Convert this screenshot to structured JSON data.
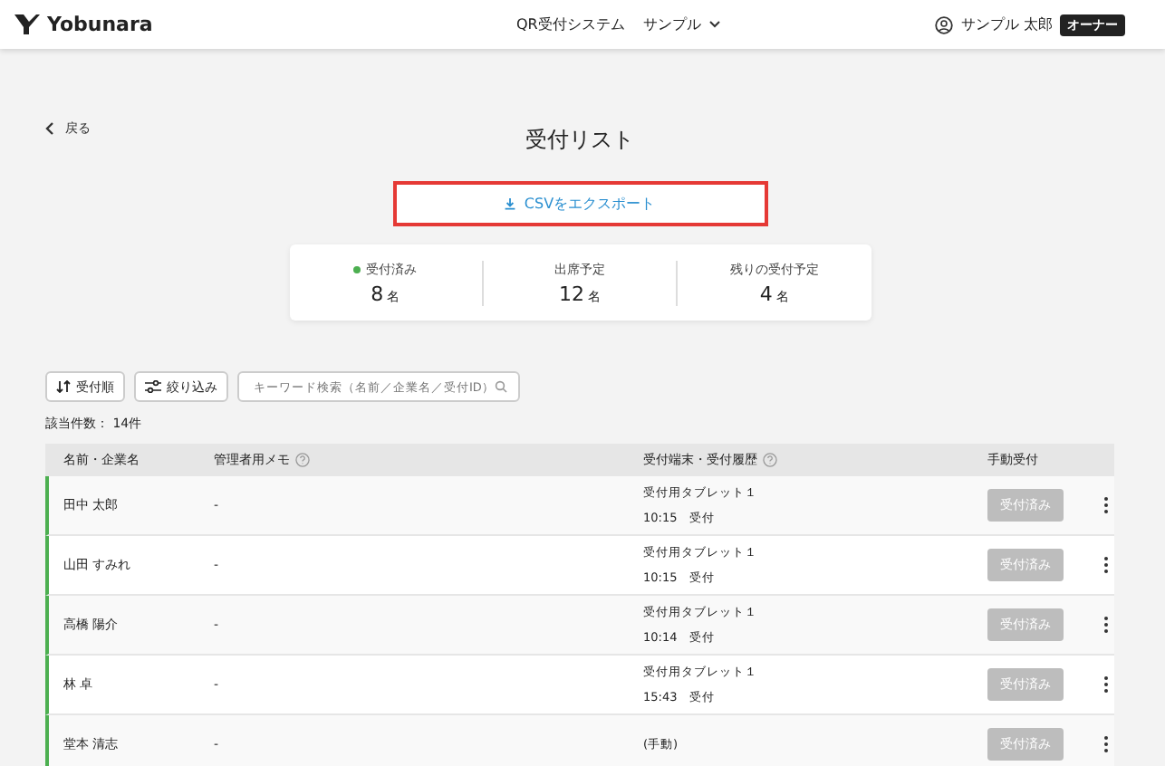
{
  "header": {
    "logo": "Yobunara",
    "nav": [
      {
        "label": "QR受付システム",
        "kind": "link"
      },
      {
        "label": "サンプル",
        "kind": "dropdown"
      }
    ],
    "user": "サンプル 太郎",
    "role": "オーナー"
  },
  "back": "戻る",
  "title": "受付リスト",
  "export_button": "CSVをエクスポート",
  "stats": [
    {
      "label": "受付済み",
      "value": "8",
      "unit": "名",
      "color": "#4caf50"
    },
    {
      "label": "出席予定",
      "value": "12",
      "unit": "名"
    },
    {
      "label": "残りの受付予定",
      "value": "4",
      "unit": "名"
    }
  ],
  "toolbar": {
    "sort_button": "受付順",
    "filter_button": "絞り込み",
    "search": {
      "placeholder": "キーワード検索（名前／企業名／受付ID）"
    }
  },
  "count": "該当件数： 14件",
  "table": {
    "columns": [
      {
        "label": "名前・企業名",
        "help": false
      },
      {
        "label": "管理者用メモ",
        "help": true
      },
      {
        "label": "受付端末・受付履歴",
        "help": true
      },
      {
        "label": "手動受付",
        "help": false
      }
    ],
    "rows": [
      {
        "name": "田中 太郎",
        "memo": "-",
        "terminal": "受付用タブレット１",
        "time": "10:15",
        "status": "受付",
        "button": "受付済み",
        "checked_in": true
      },
      {
        "name": "山田 すみれ",
        "memo": "-",
        "terminal": "受付用タブレット１",
        "time": "10:15",
        "status": "受付",
        "button": "受付済み",
        "checked_in": true
      },
      {
        "name": "高橋 陽介",
        "memo": "-",
        "terminal": "受付用タブレット１",
        "time": "10:14",
        "status": "受付",
        "button": "受付済み",
        "checked_in": true
      },
      {
        "name": "林 卓",
        "memo": "-",
        "terminal": "受付用タブレット１",
        "time": "15:43",
        "status": "受付",
        "button": "受付済み",
        "checked_in": true
      },
      {
        "name": "堂本 清志",
        "memo": "-",
        "terminal": "(手動)",
        "button": "受付済み",
        "checked_in": true
      }
    ]
  }
}
